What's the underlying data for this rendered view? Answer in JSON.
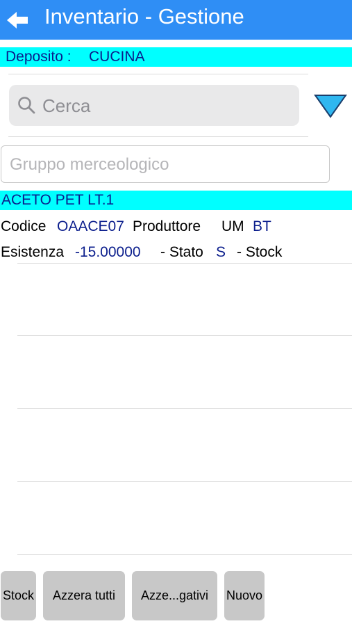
{
  "header": {
    "title": "Inventario - Gestione"
  },
  "deposit": {
    "label": "Deposito :",
    "value": "CUCINA"
  },
  "search": {
    "placeholder": "Cerca"
  },
  "group": {
    "placeholder": "Gruppo merceologico"
  },
  "item": {
    "name": "ACETO PET LT.1",
    "codice_label": "Codice",
    "codice": "OAACE07",
    "produttore_label": "Produttore",
    "um_label": "UM",
    "um": "BT",
    "esistenza_label": "Esistenza",
    "esistenza": "-15.00000",
    "stato_label": "- Stato",
    "stato": "S",
    "stock_label": "- Stock"
  },
  "buttons": {
    "stock": "Stock",
    "azzera_tutti": "Azzera tutti",
    "azzera_negativi": "Azze...gativi",
    "nuovo": "Nuovo"
  },
  "colors": {
    "header": "#2f8ef5",
    "highlight": "#00ffff",
    "value_text": "#0a1d8c",
    "button_bg": "#c8c8c8"
  }
}
